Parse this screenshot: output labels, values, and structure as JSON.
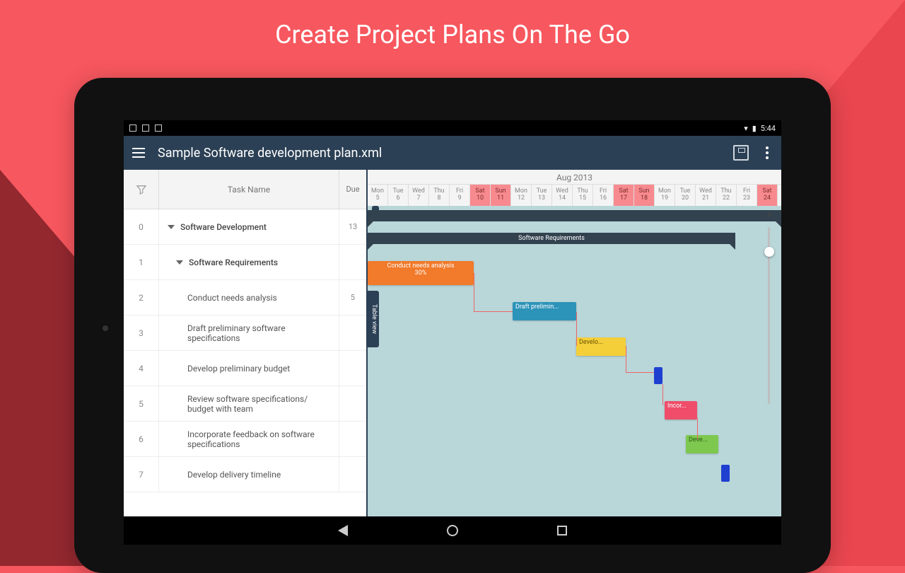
{
  "promo": {
    "title": "Create Project Plans On The Go"
  },
  "status": {
    "time": "5:44"
  },
  "appbar": {
    "title": "Sample Software development plan.xml"
  },
  "taskTable": {
    "headers": {
      "name": "Task Name",
      "dur": "Due"
    },
    "rows": [
      {
        "idx": "0",
        "name": "Software Development",
        "level": 0,
        "expandable": true,
        "dur": "13"
      },
      {
        "idx": "1",
        "name": "Software Requirements",
        "level": 1,
        "expandable": true,
        "dur": ""
      },
      {
        "idx": "2",
        "name": "Conduct needs analysis",
        "level": 2,
        "dur": "5"
      },
      {
        "idx": "3",
        "name": "Draft preliminary software specifications",
        "level": 2,
        "dur": ""
      },
      {
        "idx": "4",
        "name": "Develop preliminary budget",
        "level": 2,
        "dur": ""
      },
      {
        "idx": "5",
        "name": "Review software specifications/ budget with team",
        "level": 2,
        "dur": ""
      },
      {
        "idx": "6",
        "name": "Incorporate feedback on software specifications",
        "level": 2,
        "dur": ""
      },
      {
        "idx": "7",
        "name": "Develop delivery timeline",
        "level": 2,
        "dur": ""
      }
    ]
  },
  "timeline": {
    "month": "Aug 2013",
    "days": [
      {
        "dow": "Mon",
        "d": "5",
        "we": false
      },
      {
        "dow": "Tue",
        "d": "6",
        "we": false
      },
      {
        "dow": "Wed",
        "d": "7",
        "we": false
      },
      {
        "dow": "Thu",
        "d": "8",
        "we": false
      },
      {
        "dow": "Fri",
        "d": "9",
        "we": false
      },
      {
        "dow": "Sat",
        "d": "10",
        "we": true
      },
      {
        "dow": "Sun",
        "d": "11",
        "we": true
      },
      {
        "dow": "Mon",
        "d": "12",
        "we": false
      },
      {
        "dow": "Tue",
        "d": "13",
        "we": false
      },
      {
        "dow": "Wed",
        "d": "14",
        "we": false
      },
      {
        "dow": "Thu",
        "d": "15",
        "we": false
      },
      {
        "dow": "Fri",
        "d": "16",
        "we": false
      },
      {
        "dow": "Sat",
        "d": "17",
        "we": true
      },
      {
        "dow": "Sun",
        "d": "18",
        "we": true
      },
      {
        "dow": "Mon",
        "d": "19",
        "we": false
      },
      {
        "dow": "Tue",
        "d": "20",
        "we": false
      },
      {
        "dow": "Wed",
        "d": "21",
        "we": false
      },
      {
        "dow": "Thu",
        "d": "22",
        "we": false
      },
      {
        "dow": "Fri",
        "d": "23",
        "we": false
      },
      {
        "dow": "Sat",
        "d": "24",
        "we": true
      }
    ]
  },
  "gantt": {
    "tableViewLabel": "Table view",
    "summary1": {
      "label": "Software Requirements"
    },
    "bars": {
      "needs": "Conduct needs analysis\n30%",
      "draft": "Draft prelimin...",
      "budget": "Develo...",
      "incorp": "Incor...",
      "devl": "Deve..."
    }
  },
  "chart_data": {
    "type": "gantt",
    "month": "Aug 2013",
    "date_range": [
      "2013-08-05",
      "2013-08-24"
    ],
    "summaries": [
      {
        "name": "Software Development",
        "start": "2013-08-05",
        "end": "2013-08-24"
      },
      {
        "name": "Software Requirements",
        "start": "2013-08-05",
        "end": "2013-08-22"
      }
    ],
    "tasks": [
      {
        "id": 2,
        "name": "Conduct needs analysis",
        "start": "2013-08-05",
        "end": "2013-08-09",
        "progress": 30,
        "color": "#f17a2b"
      },
      {
        "id": 3,
        "name": "Draft preliminary software specifications",
        "start": "2013-08-12",
        "end": "2013-08-14",
        "color": "#2c93b9"
      },
      {
        "id": 4,
        "name": "Develop preliminary budget",
        "start": "2013-08-14",
        "end": "2013-08-16",
        "color": "#f4cf3a"
      },
      {
        "id": 5,
        "name": "Review software specifications/ budget with team",
        "start": "2013-08-19",
        "end": "2013-08-19",
        "milestone": true,
        "color": "#1f3fd1"
      },
      {
        "id": 6,
        "name": "Incorporate feedback on software specifications",
        "start": "2013-08-19",
        "end": "2013-08-20",
        "color": "#ef4d6a"
      },
      {
        "id": 7,
        "name": "Develop delivery timeline",
        "start": "2013-08-20",
        "end": "2013-08-21",
        "color": "#7ec850"
      }
    ],
    "dependencies": [
      [
        2,
        3
      ],
      [
        3,
        4
      ],
      [
        4,
        5
      ],
      [
        5,
        6
      ],
      [
        6,
        7
      ]
    ]
  }
}
